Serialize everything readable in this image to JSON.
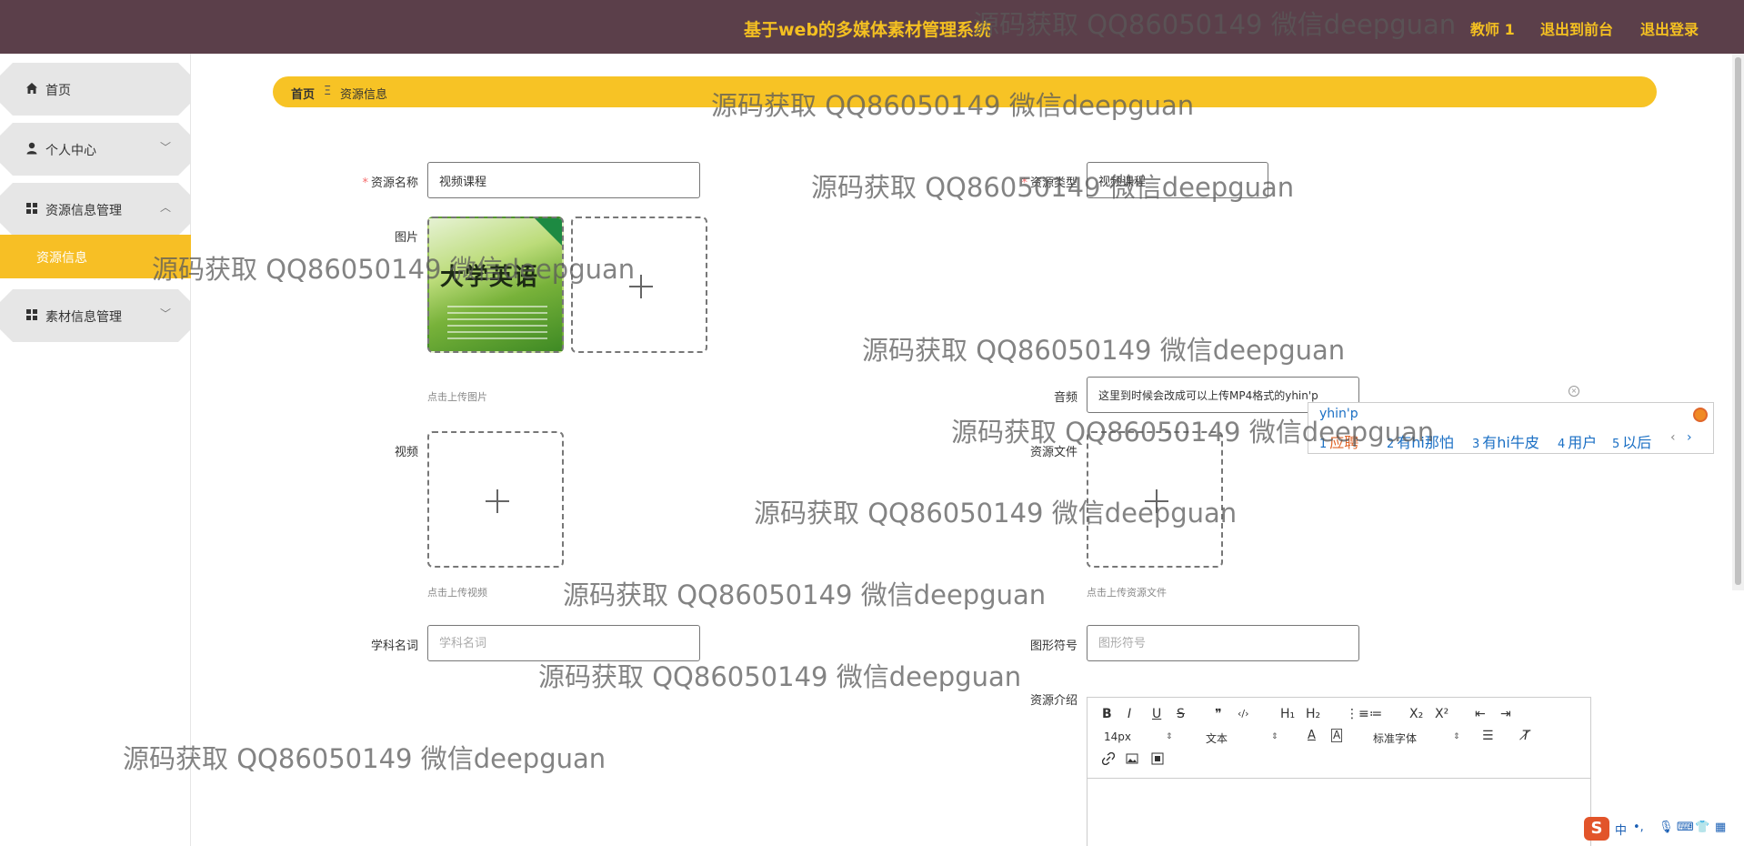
{
  "header": {
    "system_title": "基于web的多媒体素材管理系统",
    "user_label": "教师 1",
    "front_link": "退出到前台",
    "logout_link": "退出登录"
  },
  "sidebar": {
    "items": [
      {
        "label": "首页",
        "icon": "home-icon"
      },
      {
        "label": "个人中心",
        "icon": "user-icon",
        "arrow": "﹀"
      },
      {
        "label": "资源信息管理",
        "icon": "grid-icon",
        "arrow": "︿"
      },
      {
        "label": "素材信息管理",
        "icon": "grid-icon",
        "arrow": "﹀"
      }
    ],
    "active_sub": "资源信息"
  },
  "breadcrumb": {
    "home": "首页",
    "sep": "Ξ",
    "current": "资源信息"
  },
  "form": {
    "name_label": "资源名称",
    "name_value": "视频课程",
    "type_label": "资源类型",
    "type_value": "视频课程",
    "image_label": "图片",
    "image_hint": "点击上传图片",
    "book_title": "大学英语",
    "audio_label": "音频",
    "audio_value": "这里到时候会改成可以上传MP4格式的yhin'p",
    "video_label": "视频",
    "video_hint": "点击上传视频",
    "file_label": "资源文件",
    "file_hint": "点击上传资源文件",
    "subject_label": "学科名词",
    "subject_placeholder": "学科名词",
    "symbol_label": "图形符号",
    "symbol_placeholder": "图形符号",
    "intro_label": "资源介绍"
  },
  "ime": {
    "pinyin": "yhin'p",
    "candidates": [
      {
        "num": "1",
        "text": "应聘"
      },
      {
        "num": "2",
        "text": "有hi那怕"
      },
      {
        "num": "3",
        "text": "有hi牛皮"
      },
      {
        "num": "4",
        "text": "用户"
      },
      {
        "num": "5",
        "text": "以后"
      }
    ],
    "prev": "‹",
    "next": "›"
  },
  "editor": {
    "font_size": "14px",
    "block_type": "文本",
    "font_family": "标准字体",
    "buttons": [
      "B",
      "I",
      "U",
      "S",
      "❞",
      "‹/›",
      "H₁",
      "H₂",
      "⋮≡",
      "≔",
      "X₂",
      "X²",
      "⇤",
      "⇥"
    ]
  },
  "watermark": "源码获取 QQ86050149 微信deepguan",
  "sogou": {
    "logo": "S",
    "lang": "中",
    "punct": "•,"
  },
  "colors": {
    "header_bg": "#5b3f4a",
    "accent": "#f7c325",
    "header_text": "#f4c021"
  }
}
